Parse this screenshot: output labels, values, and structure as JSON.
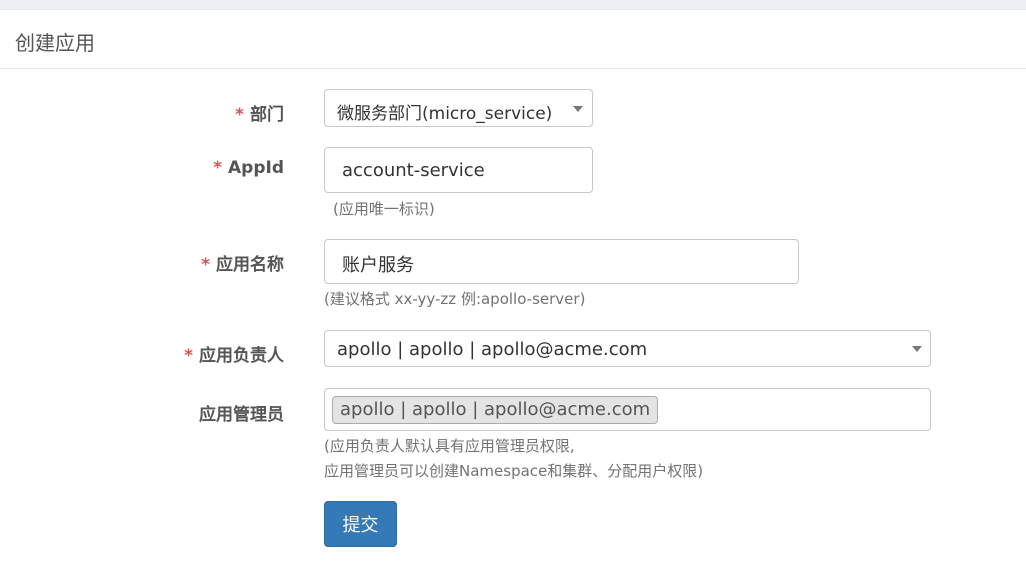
{
  "page": {
    "title": "创建应用"
  },
  "form": {
    "required_mark": "*",
    "department": {
      "label": "部门",
      "value": "微服务部门(micro_service)"
    },
    "app_id": {
      "label": "AppId",
      "value": "account-service",
      "help": "(应用唯一标识)"
    },
    "app_name": {
      "label": "应用名称",
      "value": "账户服务",
      "help": "(建议格式 xx-yy-zz 例:apollo-server)"
    },
    "owner": {
      "label": "应用负责人",
      "value": "apollo | apollo | apollo@acme.com"
    },
    "admins": {
      "label": "应用管理员",
      "tags": [
        "apollo | apollo | apollo@acme.com"
      ],
      "help_line1": "(应用负责人默认具有应用管理员权限,",
      "help_line2": "应用管理员可以创建Namespace和集群、分配用户权限)"
    },
    "submit_label": "提交"
  }
}
